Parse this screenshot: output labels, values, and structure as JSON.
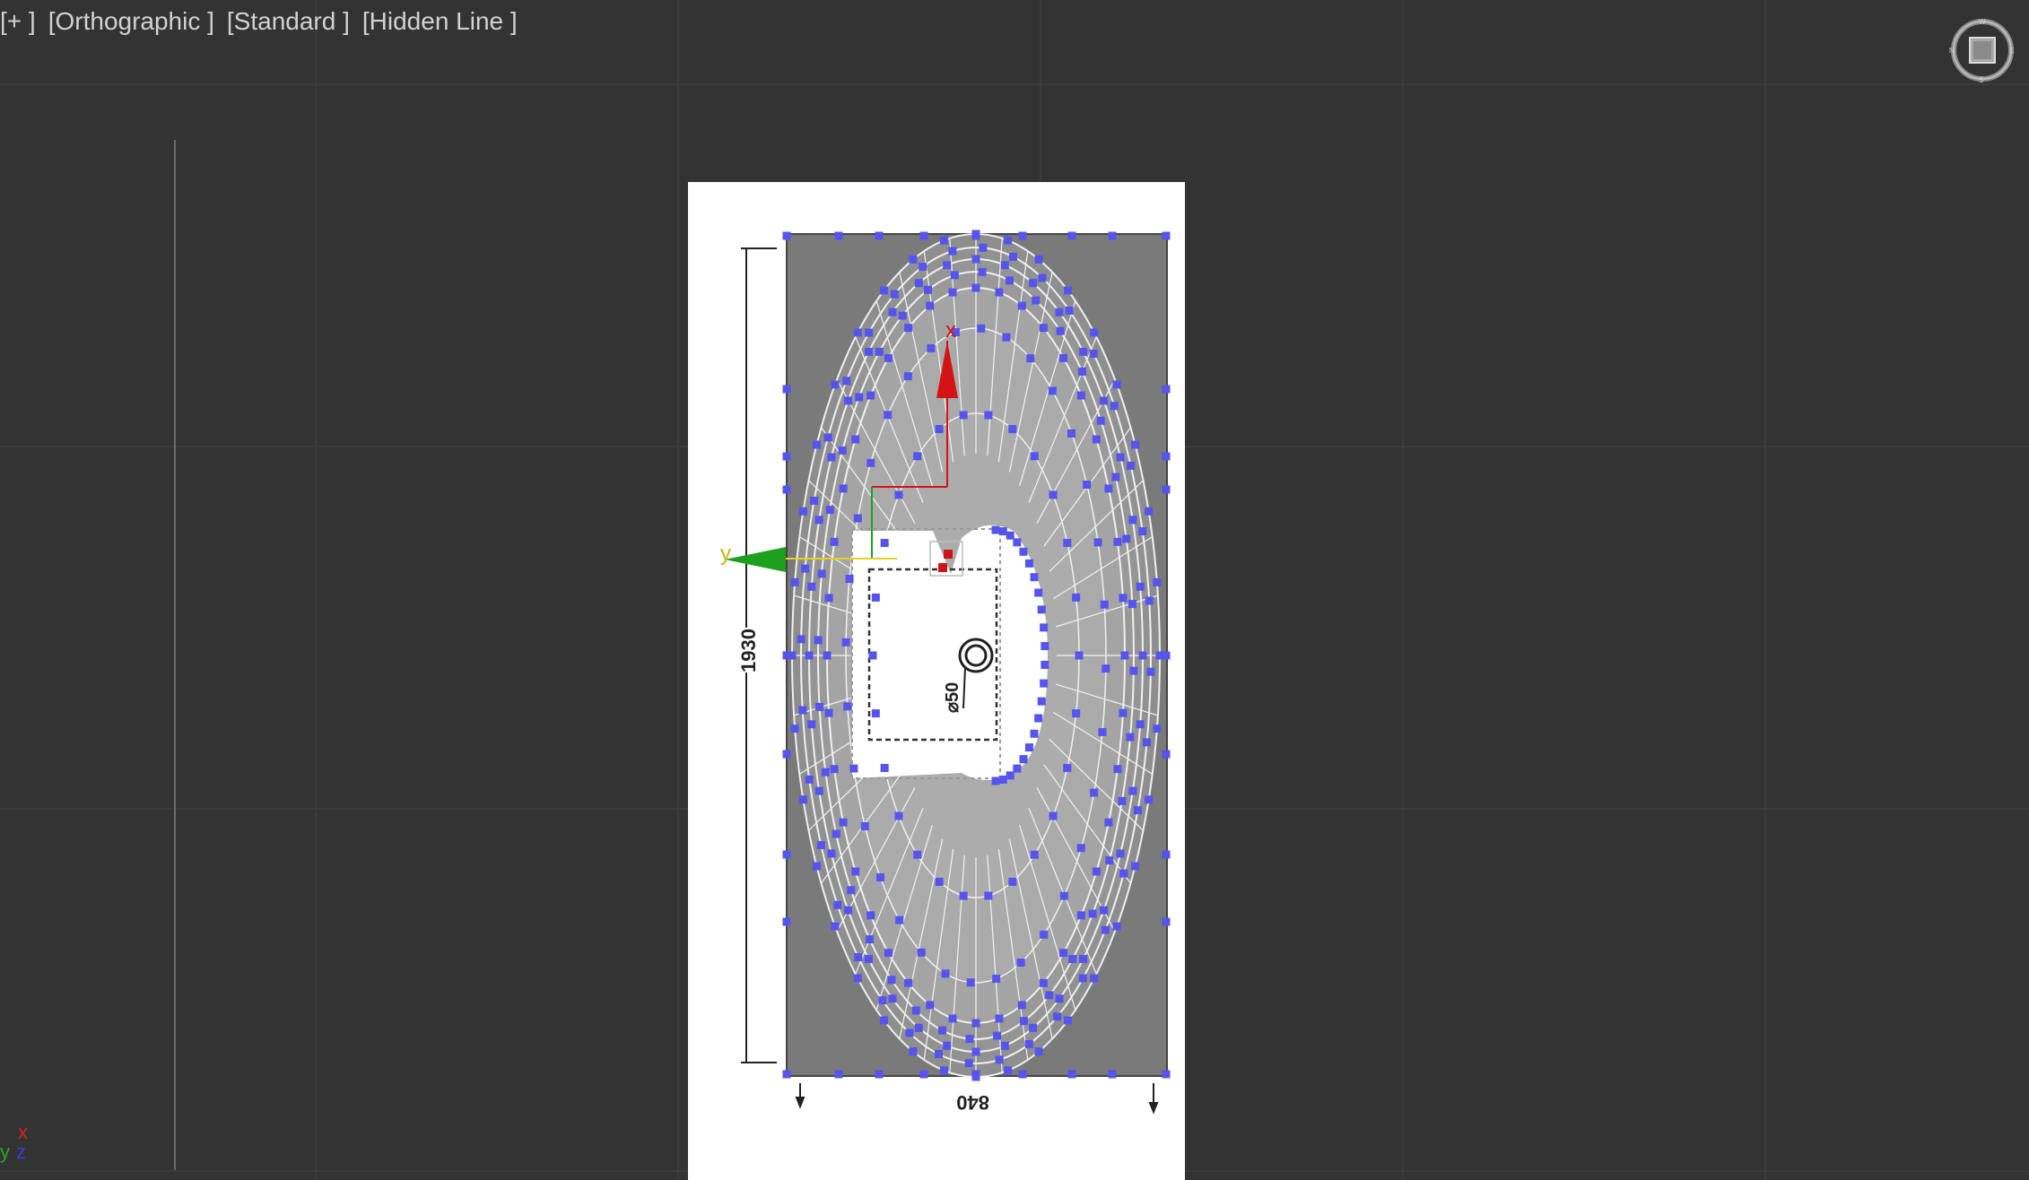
{
  "viewport": {
    "labels": [
      "[+ ]",
      "[Orthographic ]",
      "[Standard ]",
      "[Hidden Line ]"
    ]
  },
  "drawing": {
    "dimension_length": "1930",
    "dimension_width": "840",
    "drain_label": "⌀50"
  },
  "gizmo": {
    "x_label": "x",
    "y_label": "y",
    "x_color": "#d41414",
    "y_color": "#1ea01e"
  },
  "corner_axes": {
    "x": "x",
    "y": "y",
    "z": "z"
  },
  "viewcube": {
    "icon": "viewcube-icon"
  },
  "colors": {
    "background": "#333333",
    "grid": "#3d3d3d",
    "vertex": "#5555ee",
    "mesh_fill": "#a9a9a9",
    "mesh_dark": "#7a7a7a"
  }
}
